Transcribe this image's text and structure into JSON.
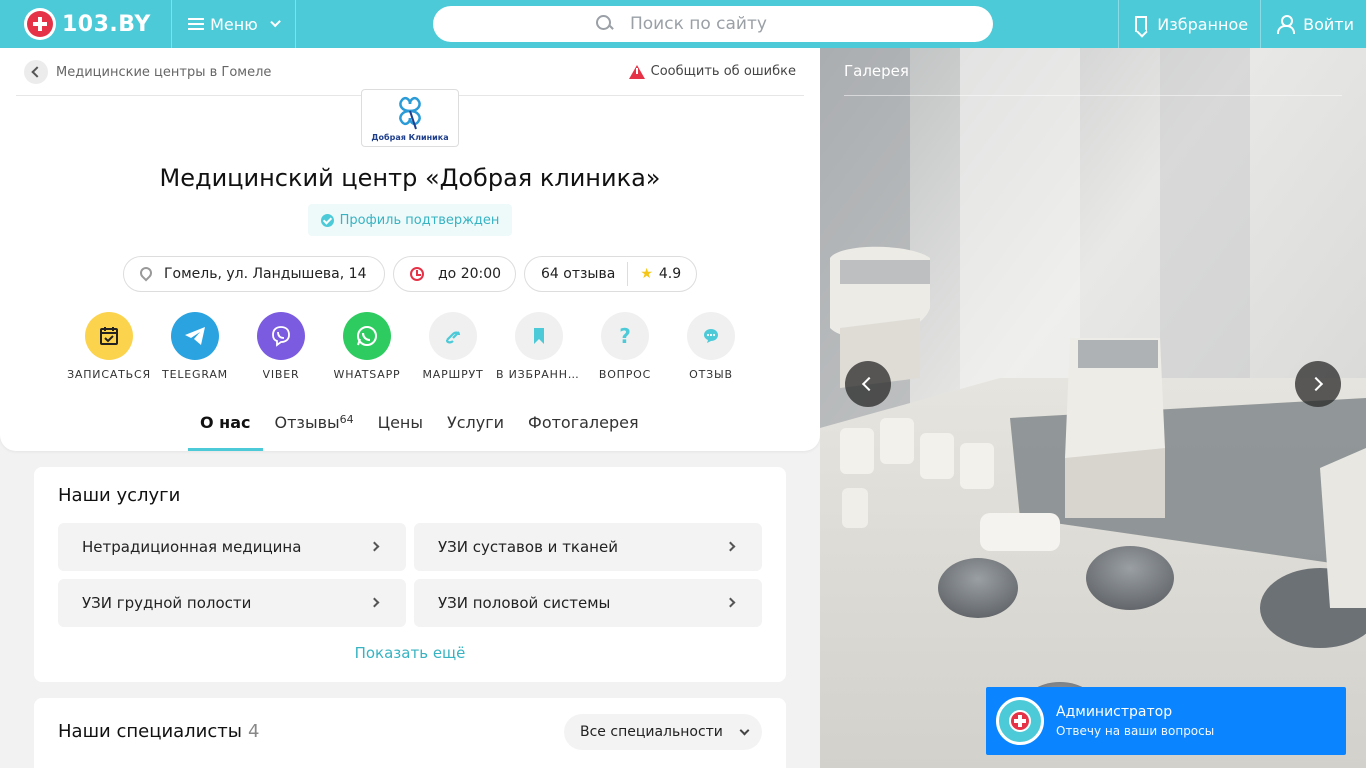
{
  "header": {
    "logo_text": "103.BY",
    "menu_label": "Меню",
    "search_placeholder": "Поиск по сайту",
    "favorites_label": "Избранное",
    "login_label": "Войти",
    "accent_color": "#4dcad8"
  },
  "breadcrumb": {
    "back_label": "Медицинские центры в Гомеле",
    "report_label": "Сообщить об ошибке"
  },
  "clinic": {
    "logo_text": "Добрая Клиника",
    "title": "Медицинский центр «Добрая клиника»",
    "verified_label": "Профиль подтвержден",
    "address": "Гомель, ул. Ландышева, 14",
    "hours": "до 20:00",
    "reviews": "64 отзыва",
    "rating": "4.9"
  },
  "actions": [
    {
      "label": "ЗАПИСАТЬСЯ",
      "icon": "calendar-icon",
      "color": "#fcd34d"
    },
    {
      "label": "TELEGRAM",
      "icon": "telegram-icon",
      "color": "#2aa3e0"
    },
    {
      "label": "VIBER",
      "icon": "viber-icon",
      "color": "#7b5ce0"
    },
    {
      "label": "WHATSAPP",
      "icon": "whatsapp-icon",
      "color": "#2ecc60"
    },
    {
      "label": "МАРШРУТ",
      "icon": "route-icon",
      "color": "#f0f0f0"
    },
    {
      "label": "В ИЗБРАННОЕ",
      "icon": "bookmark-icon",
      "color": "#f0f0f0"
    },
    {
      "label": "ВОПРОС",
      "icon": "question-icon",
      "color": "#f0f0f0"
    },
    {
      "label": "ОТЗЫВ",
      "icon": "comment-icon",
      "color": "#f0f0f0"
    }
  ],
  "tabs": [
    {
      "label": "О нас",
      "active": true
    },
    {
      "label": "Отзывы",
      "badge": "64"
    },
    {
      "label": "Цены"
    },
    {
      "label": "Услуги"
    },
    {
      "label": "Фотогалерея"
    }
  ],
  "services": {
    "title": "Наши услуги",
    "items": [
      "Нетрадиционная медицина",
      "УЗИ суставов и тканей",
      "УЗИ грудной полости",
      "УЗИ половой системы"
    ],
    "show_more": "Показать ещё"
  },
  "specialists": {
    "title": "Наши специалисты",
    "count": "4",
    "filter_label": "Все специальности"
  },
  "gallery": {
    "label": "Галерея"
  },
  "chat": {
    "name": "Администратор",
    "subtitle": "Отвечу на ваши вопросы"
  }
}
